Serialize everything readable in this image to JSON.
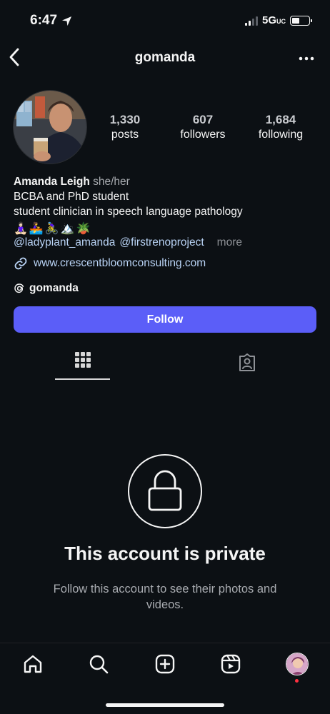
{
  "status_bar": {
    "time": "6:47",
    "network": "5G",
    "network_suffix": "UC"
  },
  "header": {
    "username": "gomanda"
  },
  "profile": {
    "stats": [
      {
        "value": "1,330",
        "label": "posts"
      },
      {
        "value": "607",
        "label": "followers"
      },
      {
        "value": "1,684",
        "label": "following"
      }
    ],
    "name": "Amanda Leigh",
    "pronouns": "she/her",
    "bio_line1": "BCBA and PhD student",
    "bio_line2": "student clinician in speech language pathology",
    "emoji_line": "🧘🏻‍♀️🚣‍♀️🚴‍♀️🏔️🪴",
    "mention1": "@ladyplant_amanda",
    "mention2": "@firstrenoproject",
    "more_label": "more",
    "link": "www.crescentbloomconsulting.com",
    "threads_handle": "gomanda"
  },
  "follow_button": {
    "label": "Follow",
    "color": "#5b5ef8"
  },
  "tabs": [
    {
      "icon": "grid-icon",
      "active": true
    },
    {
      "icon": "tagged-icon",
      "active": false
    }
  ],
  "private": {
    "title": "This account is private",
    "subtitle": "Follow this account to see their photos and videos."
  },
  "bottom_nav": [
    "home-icon",
    "search-icon",
    "create-icon",
    "reels-icon",
    "profile-avatar"
  ]
}
